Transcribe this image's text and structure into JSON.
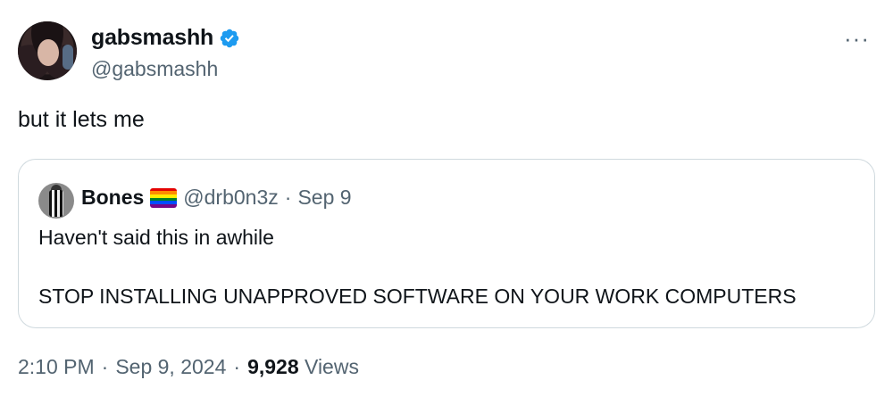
{
  "author": {
    "display_name": "gabsmashh",
    "handle": "@gabsmashh",
    "verified_icon": "verified-badge-icon",
    "verified_color": "#1d9bf0"
  },
  "more_label": "···",
  "tweet_text": "but it lets me",
  "quoted": {
    "display_name": "Bones",
    "name_emoji": "rainbow-flag-icon",
    "handle": "@drb0n3z",
    "separator": "·",
    "date": "Sep 9",
    "line1": "Haven't said this in awhile",
    "line2": "STOP INSTALLING UNAPPROVED SOFTWARE ON YOUR WORK COMPUTERS"
  },
  "meta": {
    "time": "2:10 PM",
    "sep1": "·",
    "date": "Sep 9, 2024",
    "sep2": "·",
    "views_count": "9,928",
    "views_label": "Views"
  },
  "colors": {
    "text_primary": "#0f1419",
    "text_secondary": "#536471",
    "border": "#cfd9de"
  }
}
